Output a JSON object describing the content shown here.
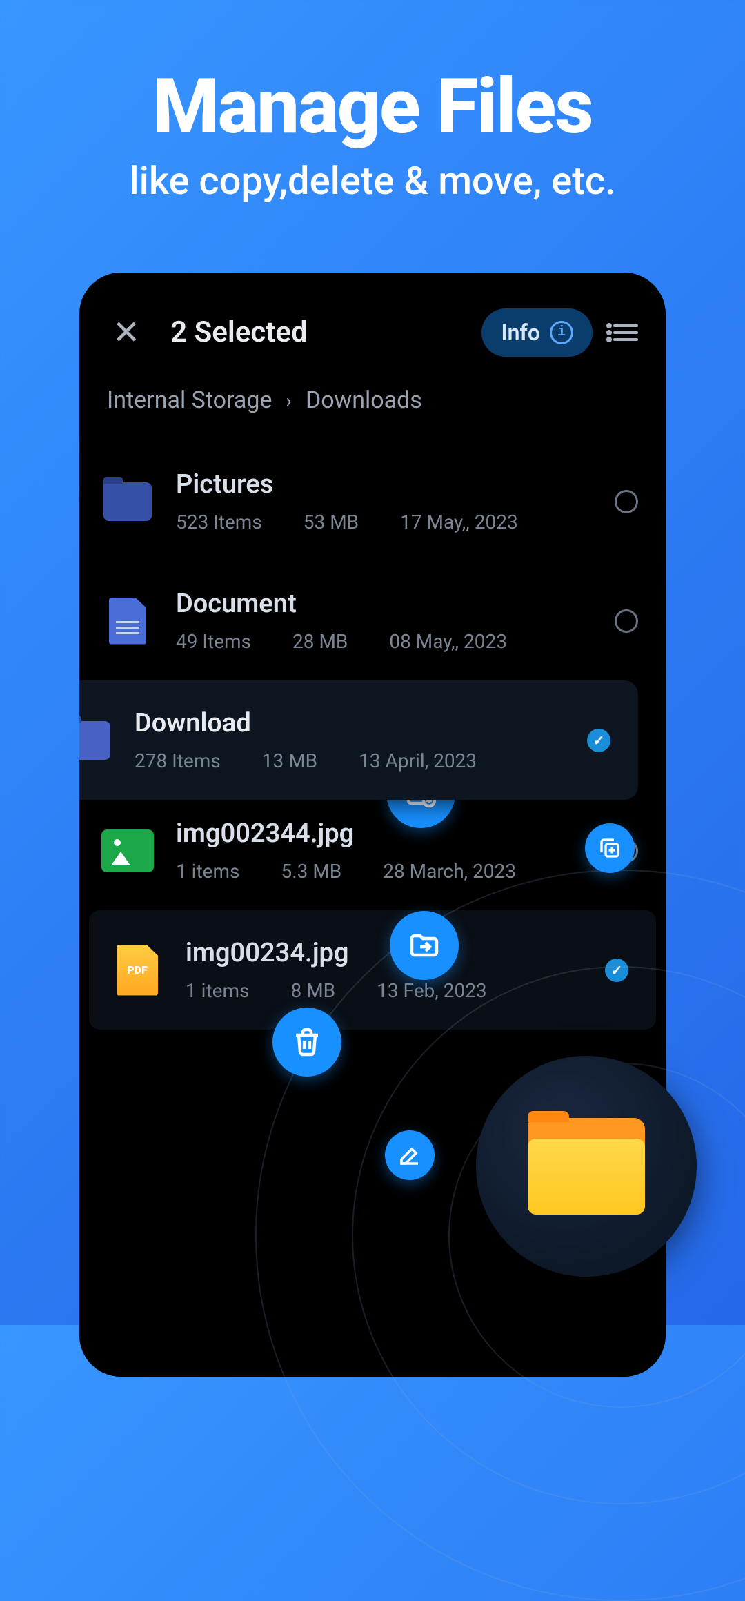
{
  "marketing": {
    "title": "Manage Files",
    "subtitle": "like copy,delete & move, etc."
  },
  "appbar": {
    "close": "✕",
    "selected": "2 Selected",
    "info_label": "Info",
    "info_symbol": "i"
  },
  "breadcrumb": {
    "root": "Internal Storage",
    "current": "Downloads"
  },
  "files": [
    {
      "name": "Pictures",
      "items": "523 Items",
      "size": "53 MB",
      "date": "17 May,, 2023",
      "type": "folder",
      "selected": false
    },
    {
      "name": "Document",
      "items": "49 Items",
      "size": "28 MB",
      "date": "08 May,, 2023",
      "type": "doc",
      "selected": false
    },
    {
      "name": "Download",
      "items": "278 Items",
      "size": "13 MB",
      "date": "13 April, 2023",
      "type": "folder",
      "selected": true
    },
    {
      "name": "img002344.jpg",
      "items": "1 items",
      "size": "5.3 MB",
      "date": "28 March, 2023",
      "type": "image",
      "selected": false
    },
    {
      "name": "img00234.jpg",
      "items": "1 items",
      "size": "8 MB",
      "date": "13 Feb, 2023",
      "type": "pdf",
      "selected": true
    }
  ],
  "pdf_label": "PDF",
  "colors": {
    "accent": "#1890ff",
    "bg": "#000",
    "folder": "#3650a8"
  }
}
